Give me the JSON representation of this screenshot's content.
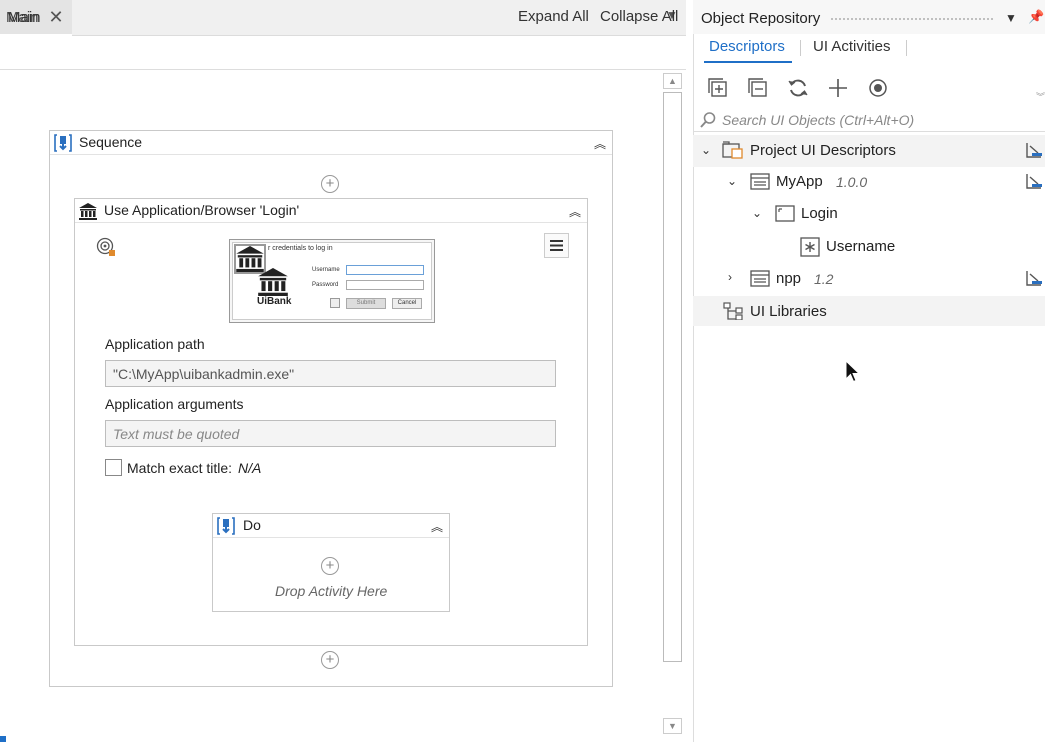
{
  "designer": {
    "tab_label": "Main",
    "breadcrumb": "Main",
    "expand_all": "Expand All",
    "collapse_all": "Collapse All",
    "sequence": {
      "title": "Sequence",
      "use_app": {
        "title": "Use Application/Browser 'Login'",
        "screenshot": {
          "prompt": "r credentials to log in",
          "username_label": "Username",
          "password_label": "Password",
          "submit": "Submit",
          "cancel": "Cancel",
          "brand": "UiBank"
        },
        "app_path_label": "Application path",
        "app_path_value": "\"C:\\MyApp\\uibankadmin.exe\"",
        "app_args_label": "Application arguments",
        "app_args_placeholder": "Text must be quoted",
        "match_title_label": "Match exact title:",
        "match_title_value": "N/A",
        "match_title_checked": false,
        "do": {
          "title": "Do",
          "drop_hint": "Drop Activity Here"
        }
      }
    }
  },
  "object_repository": {
    "title": "Object Repository",
    "tabs": [
      "Descriptors",
      "UI Activities"
    ],
    "active_tab": "Descriptors",
    "toolbar_icons": [
      "expand-all-icon",
      "collapse-all-icon",
      "refresh-icon",
      "add-icon",
      "record-icon"
    ],
    "search_placeholder": "Search UI Objects (Ctrl+Alt+O)",
    "tree": {
      "root": "Project UI Descriptors",
      "items": [
        {
          "label": "MyApp",
          "version": "1.0.0",
          "expanded": true
        },
        {
          "label": "Login",
          "expanded": true
        },
        {
          "label": "Username"
        },
        {
          "label": "npp",
          "version": "1.2",
          "expanded": false
        }
      ],
      "libraries": "UI Libraries"
    }
  },
  "colors": {
    "accent": "#1f6fc7",
    "selection": "#f3f3f3"
  }
}
